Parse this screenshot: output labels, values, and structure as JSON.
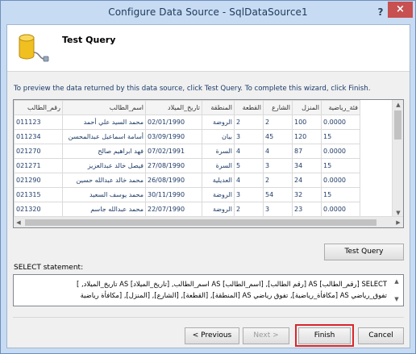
{
  "window": {
    "title": "Configure Data Source - SqlDataSource1"
  },
  "titlebar": {
    "help_glyph": "?",
    "close_glyph": "×"
  },
  "page": {
    "heading": "Test Query",
    "instructions": "To preview the data returned by this data source, click Test Query. To complete this wizard, click Finish."
  },
  "grid": {
    "columns": [
      "رقم_الطالب",
      "اسم_الطالب",
      "تاريخ_الميلاد",
      "المنطقة",
      "القطعة",
      "الشارع",
      "المنزل",
      "فئة_رياضية"
    ],
    "rows": [
      [
        "011123",
        "محمد السيد علي أحمد",
        "02/01/1990",
        "الروضة",
        "2",
        "2",
        "100",
        "0.0000"
      ],
      [
        "011234",
        "أسامة اسماعيل عبدالمحسن",
        "03/09/1990",
        "بيان",
        "3",
        "45",
        "120",
        "15"
      ],
      [
        "021270",
        "فهد ابراهيم صالح",
        "07/02/1991",
        "السرة",
        "4",
        "4",
        "87",
        "0.0000"
      ],
      [
        "021271",
        "فيصل خالد عبدالعزيز",
        "27/08/1990",
        "السرة",
        "5",
        "3",
        "34",
        "15"
      ],
      [
        "021290",
        "محمد خالد عبدالله حسين",
        "26/08/1990",
        "العديلية",
        "4",
        "2",
        "24",
        "0.0000"
      ],
      [
        "021315",
        "محمد يوسف السعيد",
        "30/11/1990",
        "الروضة",
        "3",
        "54",
        "32",
        "15"
      ],
      [
        "021320",
        "محمد عبدالله جاسم",
        "22/07/1990",
        "الروضة",
        "2",
        "3",
        "23",
        "0.0000"
      ]
    ]
  },
  "buttons": {
    "test_query": "Test Query",
    "previous": "< Previous",
    "next": "Next >",
    "finish": "Finish",
    "cancel": "Cancel"
  },
  "select_statement": {
    "label": "SELECT statement:",
    "line1": "SELECT [رقم_الطالب] AS [رقم الطالب], [اسم_الطالب] AS اسم_الطالب, [تاريخ_الميلاد] AS تاريخ_الميلاد, ]",
    "line2": "تفوق_رياضي AS [مكافأة_رياضية], تفوق رياضي AS [المنطقة], [القطعة], [الشارع], [المنزل], [مكافأة رياضية"
  },
  "icons": [
    "database-plug-icon",
    "help-icon",
    "close-icon",
    "scroll-up-icon",
    "scroll-down-icon",
    "scroll-left-icon",
    "scroll-right-icon"
  ],
  "colors": {
    "window_frame": "#c7dbf2",
    "close_red": "#c75050",
    "highlight_red": "#d9262b",
    "body_text_blue": "#1a3a6b"
  }
}
